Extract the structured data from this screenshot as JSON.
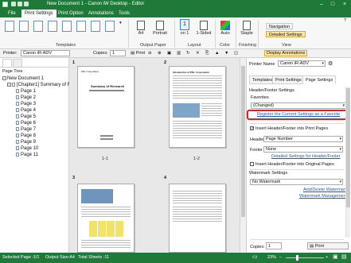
{
  "window": {
    "title": "New Document 1 - Canon iW Desktop - Editor"
  },
  "ribbon_tabs": [
    "File",
    "Print Settings",
    "Print Option",
    "Annotations",
    "Tools"
  ],
  "ribbon": {
    "templates_label": "Templates",
    "output_paper": {
      "size_value": "A4",
      "orientation": "Portrait",
      "group_label": "Output Paper"
    },
    "layout": {
      "pages_value": "1",
      "pages_unit": "on 1",
      "sided": "1-Sided",
      "group_label": "Layout"
    },
    "color": {
      "value": "Auto",
      "group_label": "Color"
    },
    "finishing": {
      "staple": "Staple",
      "group_label": "Finishing"
    },
    "view": {
      "navigation": "Navigation",
      "detailed_settings": "Detailed Settings",
      "group_label": "View"
    }
  },
  "printer_bar": {
    "printer_label": "Printer:",
    "printer_value": "Canon iR-ADV",
    "copies_label": "Copies:",
    "copies_value": "1",
    "print_label": "Print",
    "display_annotations": "Display Annotations"
  },
  "page_tree": {
    "title": "Page Tree",
    "root": "New Document 1",
    "chapter": "[Chapter1] Summary of R",
    "pages": [
      "Page 1",
      "Page 2",
      "Page 3",
      "Page 4",
      "Page 5",
      "Page 6",
      "Page 7",
      "Page 8",
      "Page 9",
      "Page 10",
      "Page 11"
    ]
  },
  "canvas": {
    "group_numbers": [
      "1",
      "2",
      "3",
      "4"
    ],
    "captions": [
      "1-1",
      "1-2"
    ],
    "page1_heading": "Summary of Research",
    "page1_company": "PDL Corporation",
    "page2_heading": "Introduction of PDL Corporation"
  },
  "right_panel": {
    "printer_name_label": "Printer Name",
    "printer_name_value": "Canon iR-ADV",
    "tabs": [
      "Templates",
      "Print Settings",
      "Page Settings"
    ],
    "section_title": "Header/Footer Settings",
    "favorites_label": "Favorites",
    "favorites_value": "(Changed)",
    "register_link": "Register the Current Settings as a Favorite",
    "insert_header_footer_print": "Insert Header/Footer into Print Pages",
    "header_label": "Header",
    "header_value": "Page Number",
    "footer_label": "Footer",
    "footer_value": "None",
    "detailed_link": "Detailed Settings for Header/Footer",
    "insert_header_footer_original": "Insert Header/Footer into Original Pages",
    "watermark_title": "Watermark Settings",
    "watermark_value": "No Watermark",
    "add_delete_watermark": "Add/Delete Watermark",
    "watermark_management": "Watermark Management",
    "copies_label": "Copies:",
    "copies_value": "1",
    "print_button": "Print"
  },
  "status_bar": {
    "selected_page": "Selected Page :1/1",
    "output_size": "Output Size:A4",
    "total_sheets": "Total Sheets :11",
    "zoom": "23%"
  },
  "colors": {
    "brand_green": "#1f7a3a",
    "highlight": "#fde5a6",
    "link_blue": "#1a5fb4",
    "callout_red": "#e02020"
  }
}
